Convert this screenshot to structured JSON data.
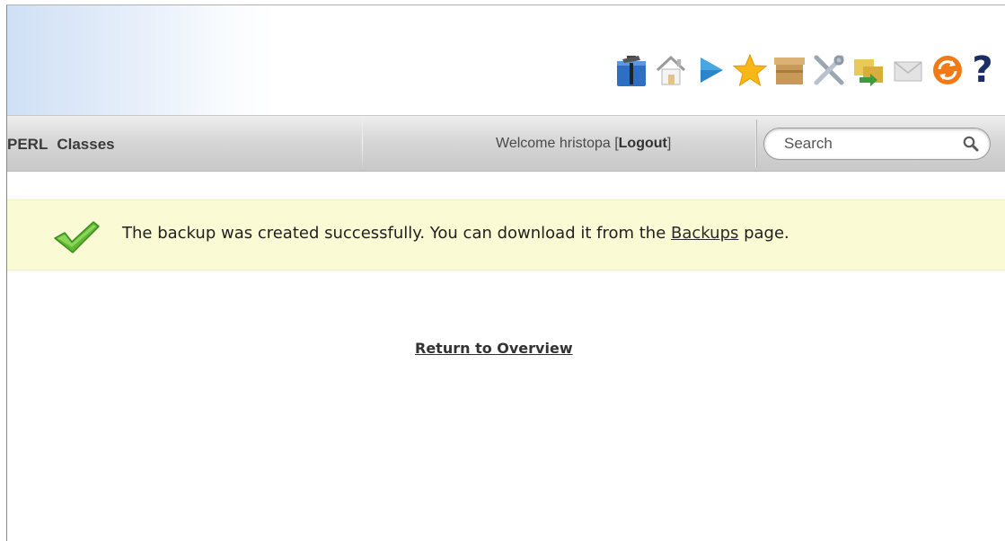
{
  "toolbar": {
    "icons": [
      "build-tools-icon",
      "home-icon",
      "play-icon",
      "favorites-star-icon",
      "archive-box-icon",
      "tools-icon",
      "transfer-icon",
      "mail-icon",
      "refresh-icon",
      "help-icon"
    ],
    "help_label": "?"
  },
  "navbar": {
    "links": [
      "PERL",
      "Classes"
    ],
    "welcome_prefix": "Welcome hristopa [",
    "logout_label": "Logout",
    "welcome_suffix": "]",
    "search_placeholder": "Search"
  },
  "notice": {
    "text_before": "The backup was created successfully. You can download it from the ",
    "link_label": "Backups",
    "text_after": " page."
  },
  "main": {
    "return_link": "Return to Overview"
  },
  "colors": {
    "notice_bg": "#fafad4",
    "help_blue": "#1b2d66",
    "check_green": "#5fb832"
  }
}
